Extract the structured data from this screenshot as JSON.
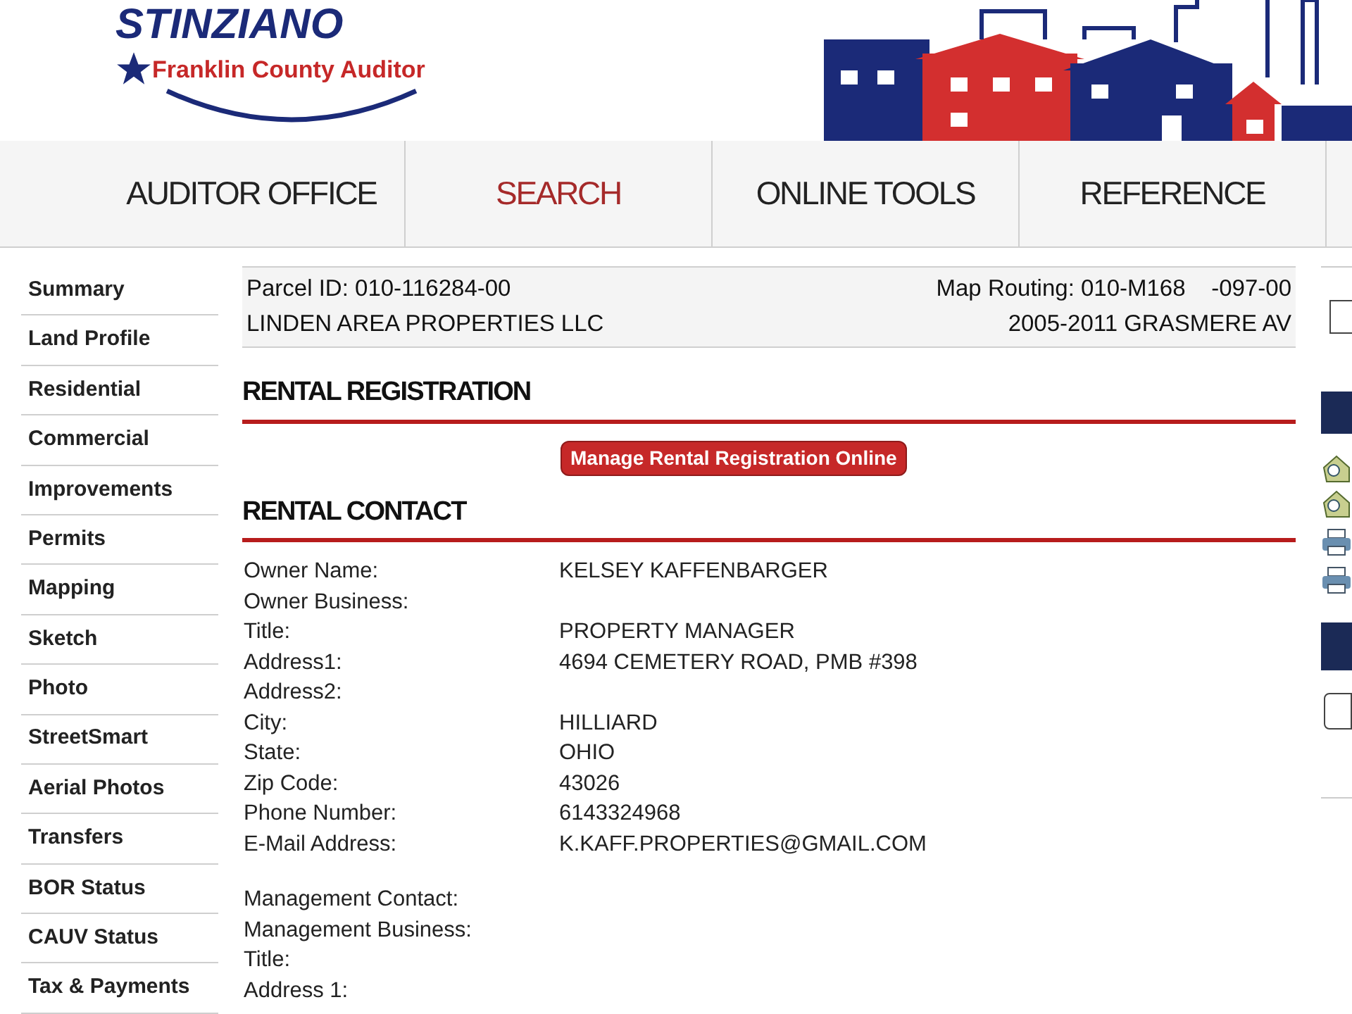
{
  "header": {
    "logo_title": "STINZIANO",
    "logo_subtitle": "Franklin County Auditor"
  },
  "nav": [
    {
      "label": "AUDITOR OFFICE",
      "selected": false
    },
    {
      "label": "SEARCH",
      "selected": true
    },
    {
      "label": "ONLINE TOOLS",
      "selected": false
    },
    {
      "label": "REFERENCE",
      "selected": false
    }
  ],
  "sidebar": {
    "items": [
      "Summary",
      "Land Profile",
      "Residential",
      "Commercial",
      "Improvements",
      "Permits",
      "Mapping",
      "Sketch",
      "Photo",
      "StreetSmart",
      "Aerial Photos",
      "Transfers",
      "BOR Status",
      "CAUV Status",
      "Tax & Payments"
    ]
  },
  "parcel": {
    "parcel_id": "Parcel ID: 010-116284-00",
    "map_routing": "Map Routing: 010-M168    -097-00",
    "owner": "LINDEN AREA PROPERTIES LLC",
    "address": "2005-2011 GRASMERE AV"
  },
  "rental_registration": {
    "heading": "RENTAL REGISTRATION",
    "button": "Manage Rental Registration Online"
  },
  "rental_contact": {
    "heading": "RENTAL CONTACT",
    "fields": [
      {
        "label": "Owner Name:",
        "value": "KELSEY KAFFENBARGER"
      },
      {
        "label": "Owner Business:"
      },
      {
        "label": "Title:",
        "value": "PROPERTY MANAGER"
      },
      {
        "label": "Address1:",
        "value": "4694 CEMETERY ROAD, PMB #398"
      },
      {
        "label": "Address2:"
      },
      {
        "label": "City:",
        "value": "HILLIARD"
      },
      {
        "label": "State:",
        "value": "OHIO"
      },
      {
        "label": "Zip Code:",
        "value": "43026"
      },
      {
        "label": "Phone Number:",
        "value": "6143324968"
      },
      {
        "label": "E-Mail Address:",
        "value": "K.KAFF.PROPERTIES@GMAIL.COM"
      }
    ],
    "management_fields": [
      {
        "label": "Management Contact:"
      },
      {
        "label": "Management Business:"
      },
      {
        "label": "Title:"
      },
      {
        "label": "Address 1:"
      }
    ]
  }
}
